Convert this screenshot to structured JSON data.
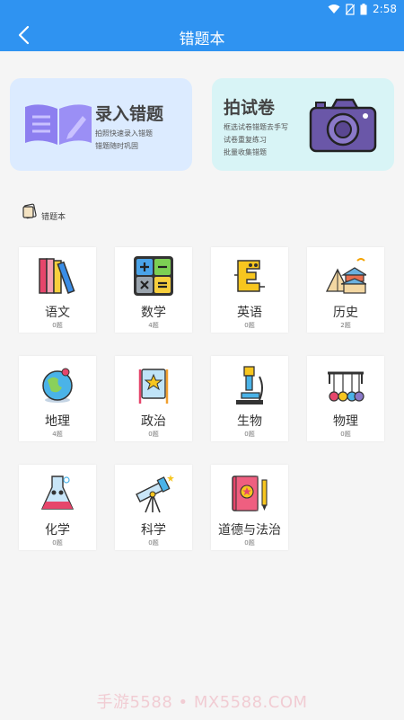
{
  "status_bar": {
    "time": "2:58"
  },
  "app_bar": {
    "title": "错题本",
    "back_icon": "chevron-left-icon"
  },
  "cards": {
    "record": {
      "title": "录入错题",
      "line1": "拍照快速录入错题",
      "line2": "错题随时巩固",
      "icon": "book-pen-icon"
    },
    "photo": {
      "title": "拍试卷",
      "line1": "框选试卷错题去手写",
      "line2": "试卷重复练习",
      "line3": "批量收集错题",
      "icon": "camera-icon"
    }
  },
  "section": {
    "label": "错题本",
    "icon": "notebook-icon"
  },
  "subjects": [
    {
      "name": "语文",
      "count": "0题",
      "icon": "books-icon"
    },
    {
      "name": "数学",
      "count": "4题",
      "icon": "calculator-icon"
    },
    {
      "name": "英语",
      "count": "0题",
      "icon": "letter-e-icon"
    },
    {
      "name": "历史",
      "count": "2题",
      "icon": "temple-icon"
    },
    {
      "name": "地理",
      "count": "4题",
      "icon": "globe-icon"
    },
    {
      "name": "政治",
      "count": "0题",
      "icon": "flag-icon"
    },
    {
      "name": "生物",
      "count": "0题",
      "icon": "microscope-icon"
    },
    {
      "name": "物理",
      "count": "0题",
      "icon": "newtons-cradle-icon"
    },
    {
      "name": "化学",
      "count": "0题",
      "icon": "flask-icon"
    },
    {
      "name": "科学",
      "count": "0题",
      "icon": "telescope-icon"
    },
    {
      "name": "道德与法治",
      "count": "0题",
      "icon": "law-book-icon"
    }
  ],
  "watermark": "手游5588 • MX5588.COM",
  "colors": {
    "primary": "#2f93f1",
    "record_card": "#dcebff",
    "photo_card": "#d8f4f6"
  }
}
